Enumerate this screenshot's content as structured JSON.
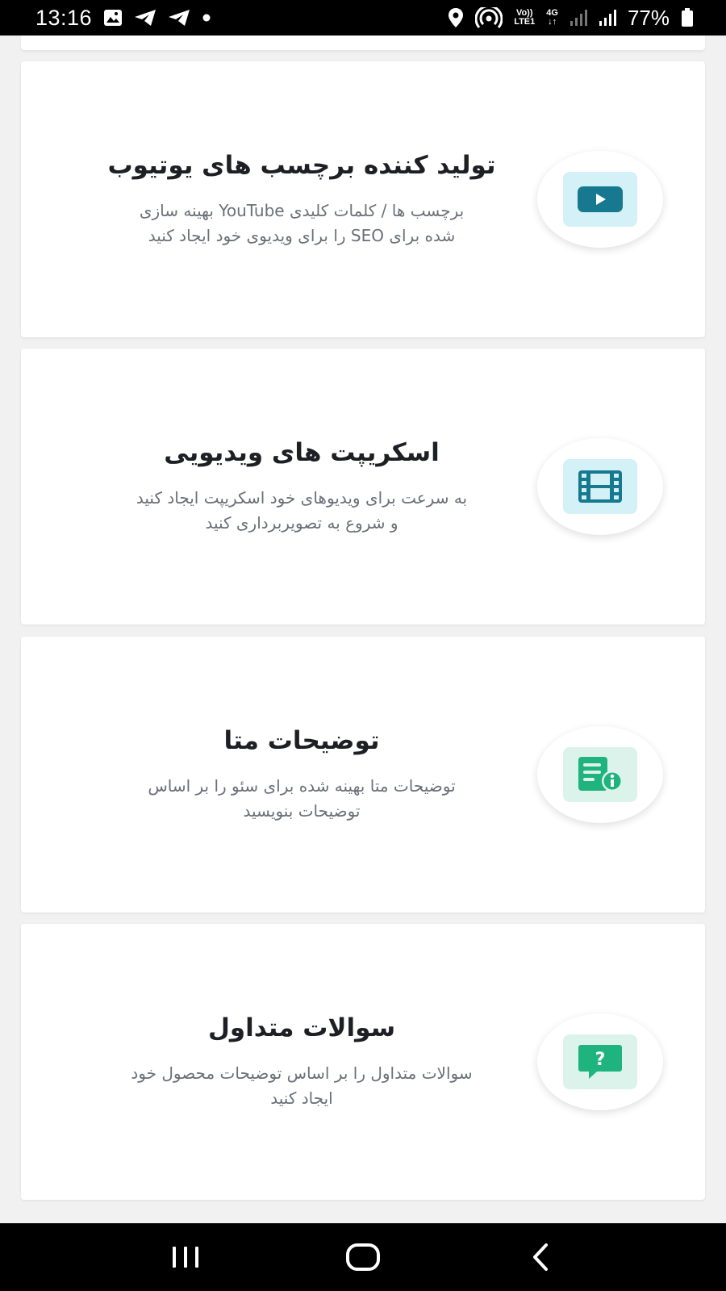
{
  "status_bar": {
    "time": "13:16",
    "volte_top": "Vo))",
    "volte_bottom": "LTE1",
    "network": "4G",
    "battery": "77%"
  },
  "colors": {
    "accent_blue": "#16798f",
    "accent_green": "#1fb47e",
    "tile_blue": "#d4f1f7",
    "tile_green": "#dcf3ec"
  },
  "cards": [
    {
      "title": "تولید کننده برچسب های یوتیوب",
      "desc_line1": "برچسب ها / کلمات کلیدی YouTube بهینه سازی",
      "desc_line2": "شده برای SEO را برای ویدیوی خود ایجاد کنید",
      "icon": "youtube-icon"
    },
    {
      "title": "اسکریپت های ویدیویی",
      "desc_line1": "به سرعت برای ویدیوهای خود اسکریپت ایجاد کنید",
      "desc_line2": "و شروع به تصویربرداری کنید",
      "icon": "film-icon"
    },
    {
      "title": "توضیحات متا",
      "desc_line1": "توضیحات متا بهینه شده برای سئو را بر اساس",
      "desc_line2": "توضیحات بنویسید",
      "icon": "document-info-icon"
    },
    {
      "title": "سوالات متداول",
      "desc_line1": "سوالات متداول را بر اساس توضیحات محصول خود",
      "desc_line2": "ایجاد کنید",
      "icon": "question-chat-icon"
    }
  ]
}
